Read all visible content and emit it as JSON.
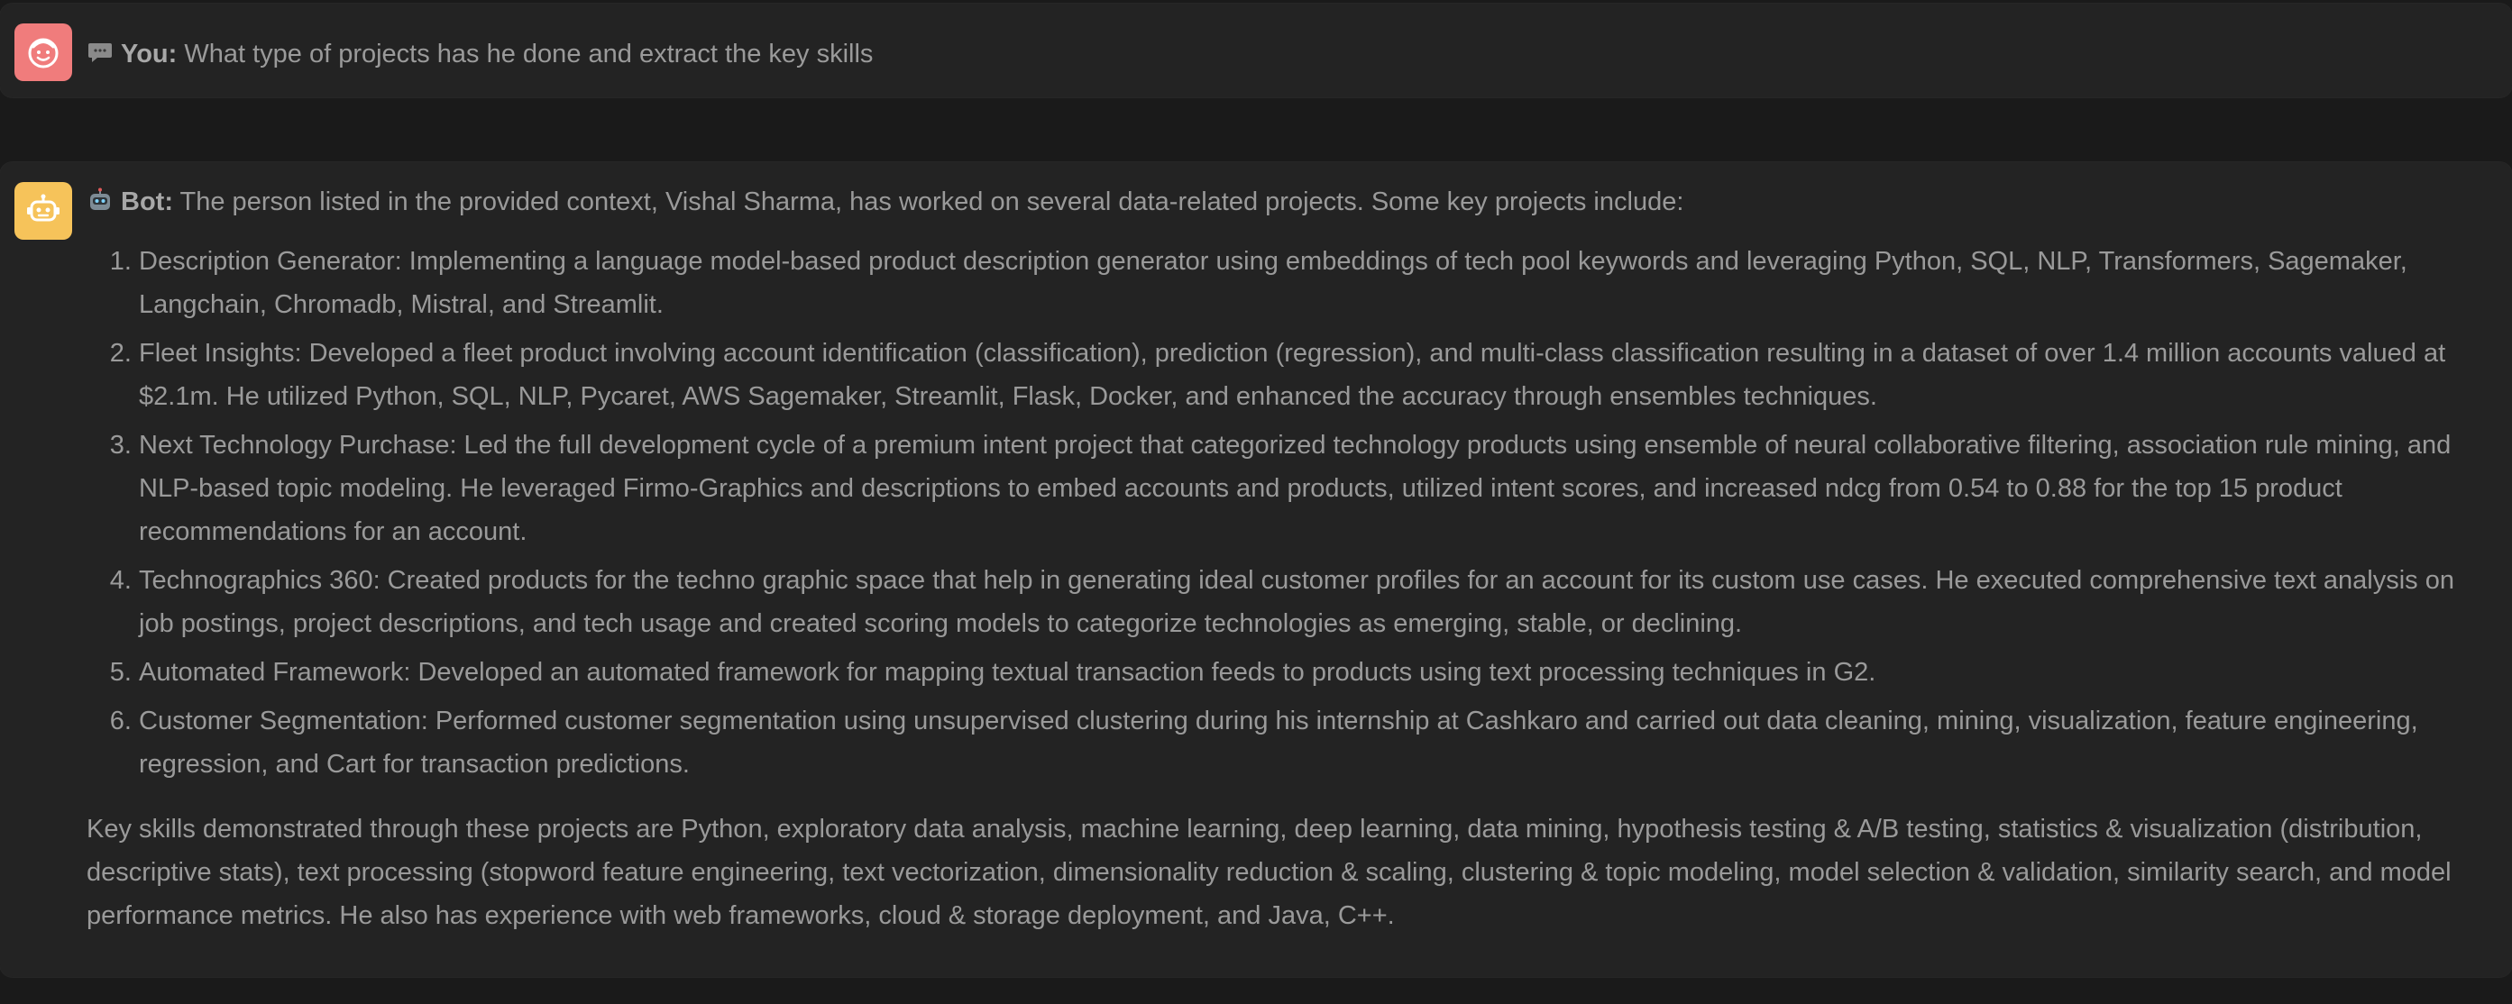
{
  "user_message": {
    "role_label": "You:",
    "text": "What type of projects has he done and extract the key skills",
    "avatar_color": "#f07c7c",
    "avatar_icon": "smiling-face-icon",
    "role_icon": "speech-bubble-icon"
  },
  "bot_message": {
    "role_label": "Bot:",
    "intro": "The person listed in the provided context, Vishal Sharma, has worked on several data-related projects. Some key projects include:",
    "avatar_color": "#f6c35a",
    "avatar_icon": "robot-icon",
    "role_icon": "robot-face-icon",
    "projects": [
      "Description Generator: Implementing a language model-based product description generator using embeddings of tech pool keywords and leveraging Python, SQL, NLP, Transformers, Sagemaker, Langchain, Chromadb, Mistral, and Streamlit.",
      "Fleet Insights: Developed a fleet product involving account identification (classification), prediction (regression), and multi-class classification resulting in a dataset of over 1.4 million accounts valued at $2.1m. He utilized Python, SQL, NLP, Pycaret, AWS Sagemaker, Streamlit, Flask, Docker, and enhanced the accuracy through ensembles techniques.",
      "Next Technology Purchase: Led the full development cycle of a premium intent project that categorized technology products using ensemble of neural collaborative filtering, association rule mining, and NLP-based topic modeling. He leveraged Firmo-Graphics and descriptions to embed accounts and products, utilized intent scores, and increased ndcg from 0.54 to 0.88 for the top 15 product recommendations for an account.",
      "Technographics 360: Created products for the techno graphic space that help in generating ideal customer profiles for an account for its custom use cases. He executed comprehensive text analysis on job postings, project descriptions, and tech usage and created scoring models to categorize technologies as emerging, stable, or declining.",
      "Automated Framework: Developed an automated framework for mapping textual transaction feeds to products using text processing techniques in G2.",
      "Customer Segmentation: Performed customer segmentation using unsupervised clustering during his internship at Cashkaro and carried out data cleaning, mining, visualization, feature engineering, regression, and Cart for transaction predictions."
    ],
    "summary": "Key skills demonstrated through these projects are Python, exploratory data analysis, machine learning, deep learning, data mining, hypothesis testing & A/B testing, statistics & visualization (distribution, descriptive stats), text processing (stopword feature engineering, text vectorization, dimensionality reduction & scaling, clustering & topic modeling, model selection & validation, similarity search, and model performance metrics. He also has experience with web frameworks, cloud & storage deployment, and Java, C++."
  }
}
